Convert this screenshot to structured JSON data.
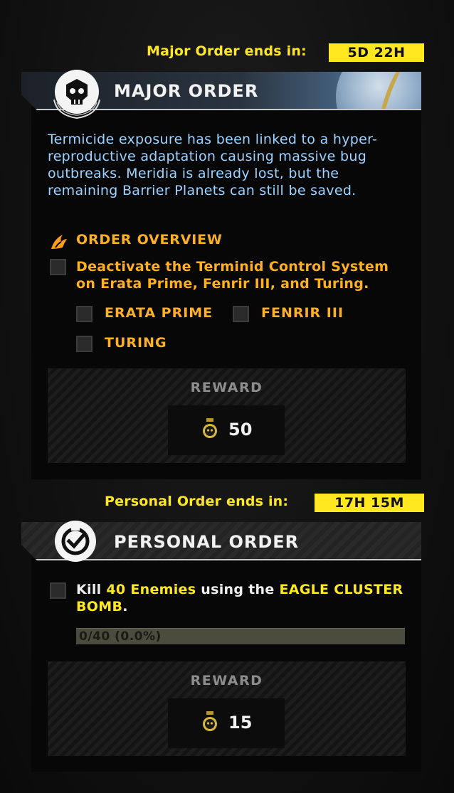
{
  "major_order": {
    "timer_label": "Major Order ends in:",
    "timer_value": "5D 22H",
    "title": "MAJOR ORDER",
    "description": "Termicide exposure has been linked to a hyper-reproductive adaptation causing massive bug outbreaks. Meridia is already lost, but the remaining Barrier Planets can still be saved.",
    "overview_label": "ORDER OVERVIEW",
    "objective": "Deactivate the Terminid Control System on Erata Prime, Fenrir III, and Turing.",
    "planets": [
      {
        "name": "ERATA PRIME",
        "checked": false
      },
      {
        "name": "FENRIR III",
        "checked": false
      },
      {
        "name": "TURING",
        "checked": false
      }
    ],
    "reward_label": "REWARD",
    "reward_value": "50",
    "reward_icon": "medal-icon"
  },
  "personal_order": {
    "timer_label": "Personal Order ends in:",
    "timer_value": "17H 15M",
    "title": "PERSONAL ORDER",
    "task": {
      "prefix": "Kill ",
      "count_phrase": "40 Enemies",
      "middle": " using the ",
      "weapon": "EAGLE CLUSTER BOMB",
      "suffix": "."
    },
    "progress_text": "0/40 (0.0%)",
    "progress_fraction": 0.0,
    "reward_label": "REWARD",
    "reward_value": "15",
    "reward_icon": "medal-icon"
  },
  "colors": {
    "accent_yellow": "#ffe81f",
    "objective_orange": "#ffb020",
    "description_blue": "#9fd3ff"
  }
}
